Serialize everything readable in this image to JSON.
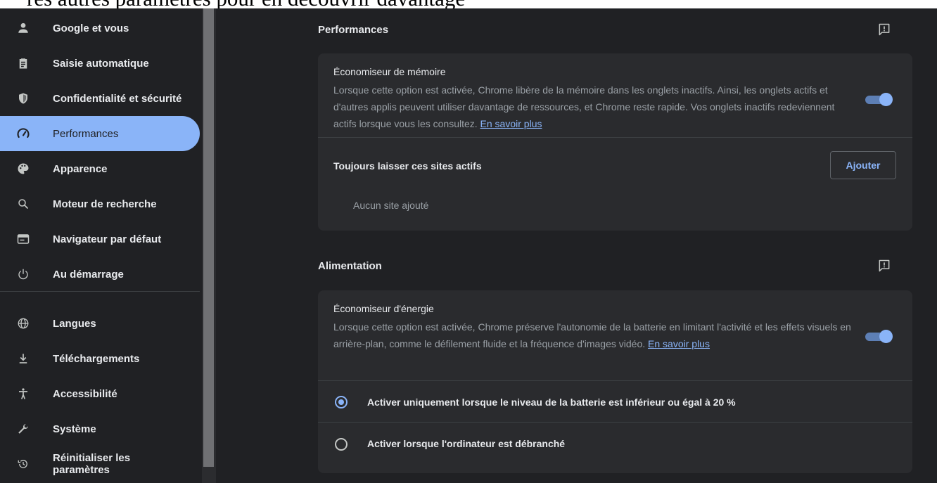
{
  "top_strip_text": "res autres paramètres pour en découvrir davantage",
  "sidebar": {
    "items": [
      {
        "label": "Google et vous",
        "icon": "person-icon"
      },
      {
        "label": "Saisie automatique",
        "icon": "clipboard-icon"
      },
      {
        "label": "Confidentialité et sécurité",
        "icon": "shield-icon"
      },
      {
        "label": "Performances",
        "icon": "speedometer-icon",
        "active": true
      },
      {
        "label": "Apparence",
        "icon": "palette-icon"
      },
      {
        "label": "Moteur de recherche",
        "icon": "search-icon"
      },
      {
        "label": "Navigateur par défaut",
        "icon": "browser-window-icon"
      },
      {
        "label": "Au démarrage",
        "icon": "power-icon"
      },
      {
        "label": "Langues",
        "icon": "globe-icon"
      },
      {
        "label": "Téléchargements",
        "icon": "download-icon"
      },
      {
        "label": "Accessibilité",
        "icon": "accessibility-icon"
      },
      {
        "label": "Système",
        "icon": "wrench-icon"
      },
      {
        "label": "Réinitialiser les paramètres",
        "icon": "restore-icon"
      }
    ]
  },
  "performance": {
    "title": "Performances",
    "memory_saver": {
      "title": "Économiseur de mémoire",
      "description": "Lorsque cette option est activée, Chrome libère de la mémoire dans les onglets inactifs. Ainsi, les onglets actifs et d'autres applis peuvent utiliser davantage de ressources, et Chrome reste rapide. Vos onglets inactifs redeviennent actifs lorsque vous les consultez.",
      "link": "En savoir plus",
      "enabled": true
    },
    "always_active": {
      "label": "Toujours laisser ces sites actifs",
      "add_button": "Ajouter",
      "empty": "Aucun site ajouté"
    }
  },
  "power": {
    "title": "Alimentation",
    "energy_saver": {
      "title": "Économiseur d'énergie",
      "description": "Lorsque cette option est activée, Chrome préserve l'autonomie de la batterie en limitant l'activité et les effets visuels en arrière-plan, comme le défilement fluide et la fréquence d'images vidéo.",
      "link": "En savoir plus",
      "enabled": true
    },
    "options": [
      {
        "label": "Activer uniquement lorsque le niveau de la batterie est inférieur ou égal à 20 %",
        "checked": true
      },
      {
        "label": "Activer lorsque l'ordinateur est débranché",
        "checked": false
      }
    ]
  },
  "colors": {
    "accent": "#8ab4f8",
    "background": "#202124",
    "card": "#2a2b2e"
  }
}
